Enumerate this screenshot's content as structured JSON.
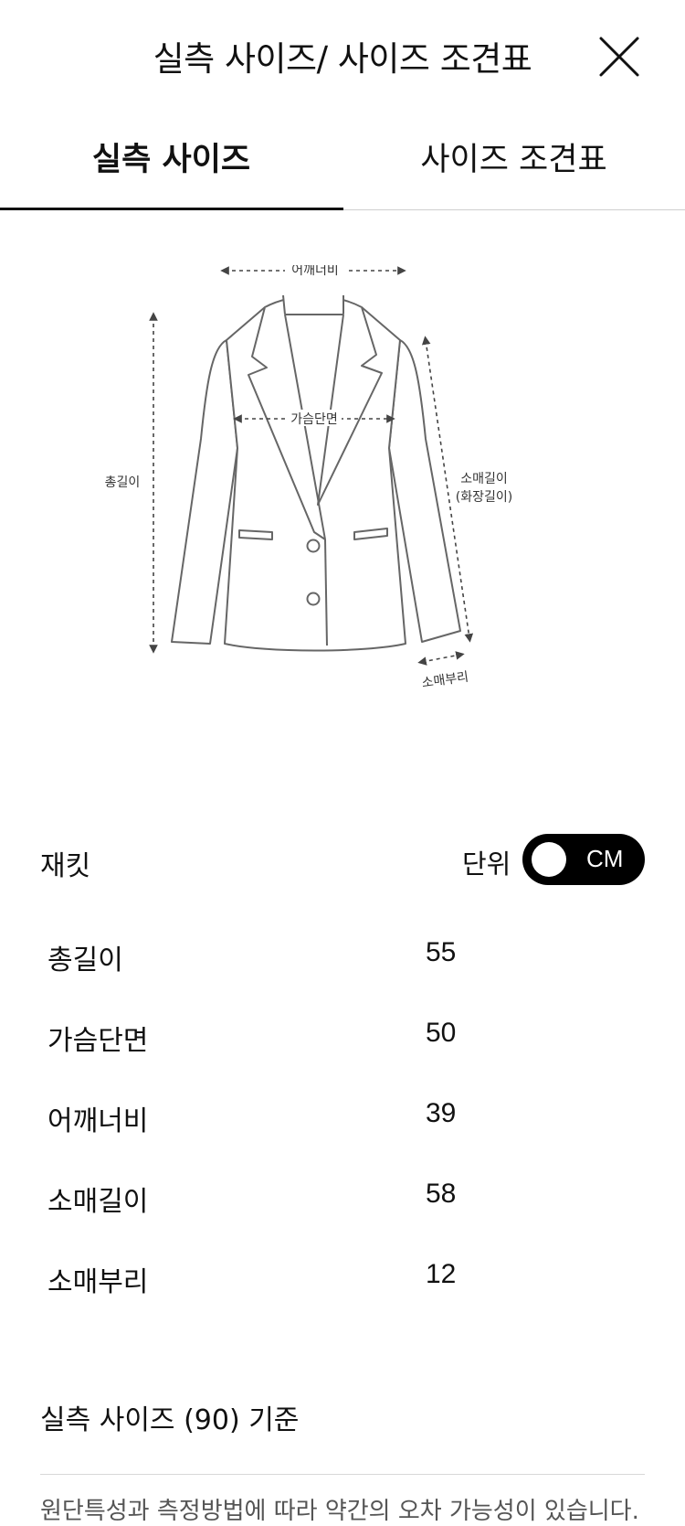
{
  "header": {
    "title": "실측 사이즈/ 사이즈 조견표",
    "close_icon": "close-icon"
  },
  "tabs": [
    {
      "label": "실측 사이즈",
      "active": true
    },
    {
      "label": "사이즈 조견표",
      "active": false
    }
  ],
  "diagram": {
    "labels": {
      "shoulder": "어깨너비",
      "chest": "가슴단면",
      "length": "총길이",
      "sleeve": "소매길이",
      "sleeve_alt": "(화장길이)",
      "cuff": "소매부리"
    }
  },
  "garment": {
    "name": "재킷",
    "unit_label": "단위",
    "unit_value": "CM"
  },
  "measurements": [
    {
      "label": "총길이",
      "value": "55"
    },
    {
      "label": "가슴단면",
      "value": "50"
    },
    {
      "label": "어깨너비",
      "value": "39"
    },
    {
      "label": "소매길이",
      "value": "58"
    },
    {
      "label": "소매부리",
      "value": "12"
    }
  ],
  "basis": "실측 사이즈 (90) 기준",
  "note": "원단특성과 측정방법에 따라 약간의 오차 가능성이 있습니다."
}
